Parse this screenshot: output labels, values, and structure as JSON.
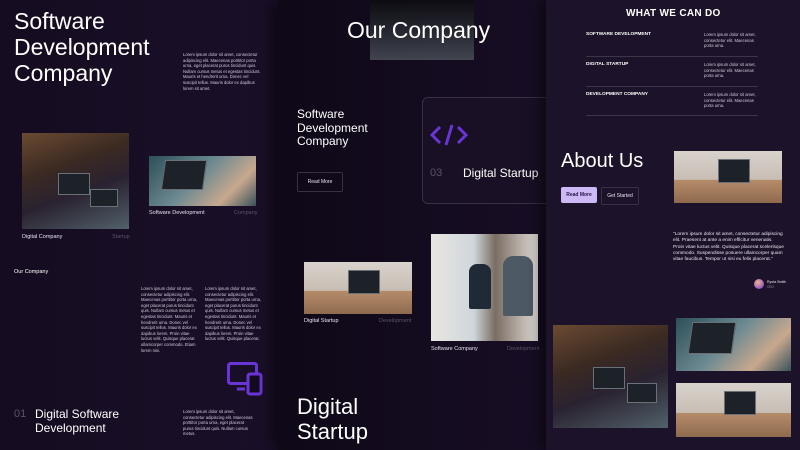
{
  "panel1": {
    "hero_title_lines": [
      "Software",
      "Development",
      "Company"
    ],
    "hero_paragraph": "Lorem ipsum dolor sit amet, consectetur adipiscing elit. Maecenas porttitor porta urna, eget placerat purus tincidunt quis. Nullam cursus metus et egestas tincidunt. Mauris et hendrerit urna. Donec vel suscipit tellus. Mauris dolor ex dapibus lorem sit amet.",
    "card1_caption": "Digital Company",
    "card1_caption_dim": "Startup",
    "card2_caption": "Software Development",
    "card2_caption_dim": "Company",
    "section_label": "Our Company",
    "col1_text": "Lorem ipsum dolor sit amet, consectetur adipiscing elit. Maecenas porttitor porta urna, eget placerat purus tincidunt quis. Nullam cursus metus et egestas tincidunt. Mauris et hendrerit urna. Donec vel suscipit tellus. Mauris dolor ex dapibus lorem. Proin vitae luctus velit. Quisque placerat ullamcorper commodo. Etiam lorem nisi.",
    "col2_text": "Lorem ipsum dolor sit amet, consectetur adipiscing elit. Maecenas porttitor porta urna, eget placerat purus tincidunt quis. Nullam cursus metus et egestas tincidunt. Mauris et hendrerit urna. Donec vel suscipit tellus. Mauris dolor ex dapibus lorem. Proin vitae luctus velit. Quisque placerat.",
    "service_number": "01",
    "service_title_lines": [
      "Digital Software",
      "Development"
    ],
    "service_text": "Lorem ipsum dolor sit amet, consectetur adipiscing elit. Maecenas porttitor porta urna, eget placerat purus tincidunt quis. Nullam cursus metus."
  },
  "panel2": {
    "title": "Our Company",
    "subtitle_lines": [
      "Software",
      "Development",
      "Company"
    ],
    "read_more": "Read More",
    "service_number": "03",
    "service_title": "Digital Startup",
    "card1_caption": "Digital Startup",
    "card1_caption_dim": "Development",
    "card2_caption": "Software Company",
    "card2_caption_dim": "Development",
    "bottom_title_lines": [
      "Digital",
      "Startup"
    ]
  },
  "panel3": {
    "heading": "WHAT WE CAN DO",
    "services": [
      {
        "name": "SOFTWARE DEVELOPMENT",
        "text": "Lorem ipsum dolor sit amet, consectetur elit. Maecenas porta urna."
      },
      {
        "name": "DIGITAL STARTUP",
        "text": "Lorem ipsum dolor sit amet, consectetur elit. Maecenas porta urna."
      },
      {
        "name": "DEVELOPMENT COMPANY",
        "text": "Lorem ipsum dolor sit amet, consectetur elit. Maecenas porta urna."
      }
    ],
    "about_title": "About Us",
    "read_more": "Read More",
    "get_started": "Get Started",
    "quote": "\"Lorem ipsum dolor sit amet, consectetur adipiscing elit. Praesent at ante a enim efficitur venenatis. Proin vitae luctus velit. Quisque placerat scelerisque commodo. Suspendisse posuere ullamcorper quam vitae faucibus. Tempor ut nisi eu felis placerat.\"",
    "author_name": "Ryota Smith",
    "author_role": "CEO"
  },
  "colors": {
    "accent": "#6a35d6",
    "button_light": "#cdb9f5",
    "background": "#140b1f"
  }
}
